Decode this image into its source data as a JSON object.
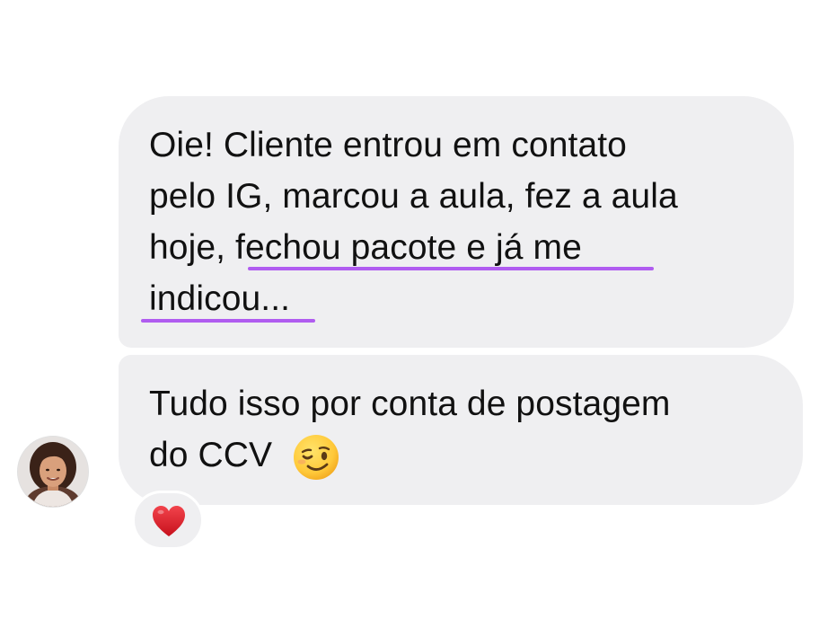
{
  "conversation": {
    "messages": [
      {
        "lines": [
          "Oie! Cliente entrou em contato",
          "pelo IG, marcou a aula, fez a aula",
          "hoje, fechou pacote e já me",
          "indicou..."
        ],
        "highlighted": "fechou pacote e já me indicou..."
      },
      {
        "lines": [
          "Tudo isso por conta de postagem",
          "do CCV"
        ],
        "emoji": "winking-face"
      }
    ],
    "reaction": "heart",
    "colors": {
      "bubble": "#EFEFF1",
      "underline": "#B05CF0",
      "text": "#111111"
    }
  }
}
